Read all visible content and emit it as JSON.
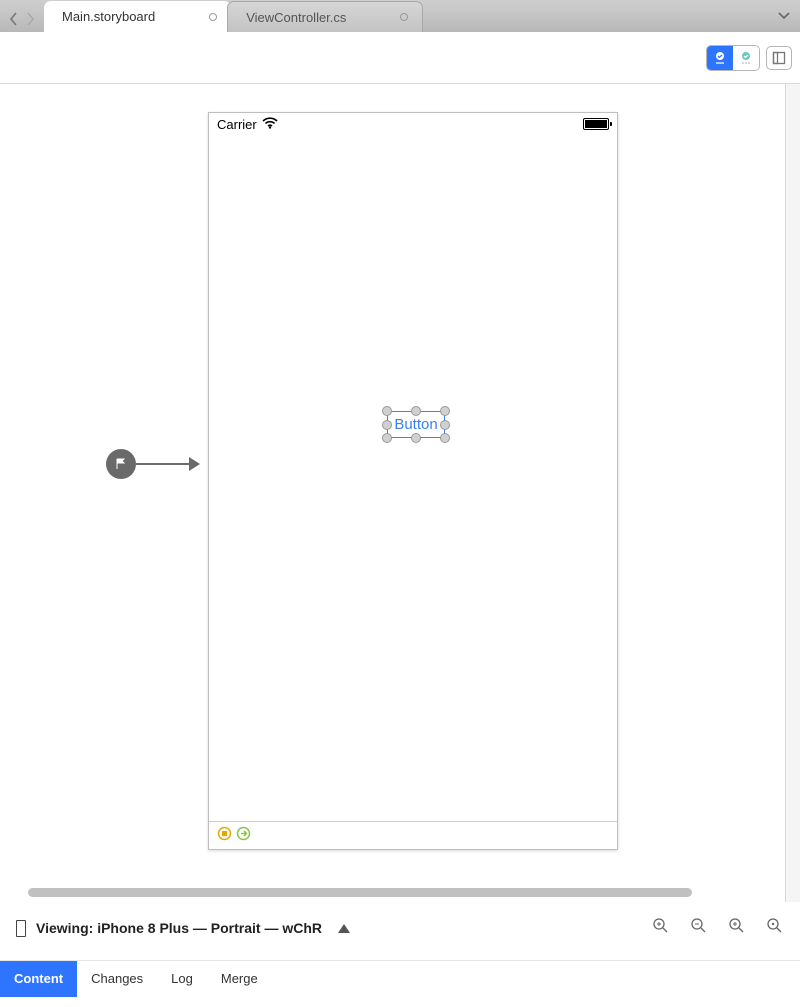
{
  "tabs": [
    {
      "label": "Main.storyboard",
      "active": true
    },
    {
      "label": "ViewController.cs",
      "active": false
    }
  ],
  "toolbar": {
    "auto_layout_enabled_icon": "auto-layout-toggle",
    "auto_layout_disabled_icon": "auto-layout-toggle-alt",
    "outline_icon": "outline-toggle"
  },
  "statusbar": {
    "carrier": "Carrier"
  },
  "canvas": {
    "selected_element": {
      "label": "Button"
    }
  },
  "viewbar": {
    "prefix": "Viewing:",
    "device": "iPhone 8 Plus",
    "orientation": "Portrait",
    "size_class": "wChR"
  },
  "bottom_tabs": [
    "Content",
    "Changes",
    "Log",
    "Merge"
  ],
  "bottom_active": "Content"
}
